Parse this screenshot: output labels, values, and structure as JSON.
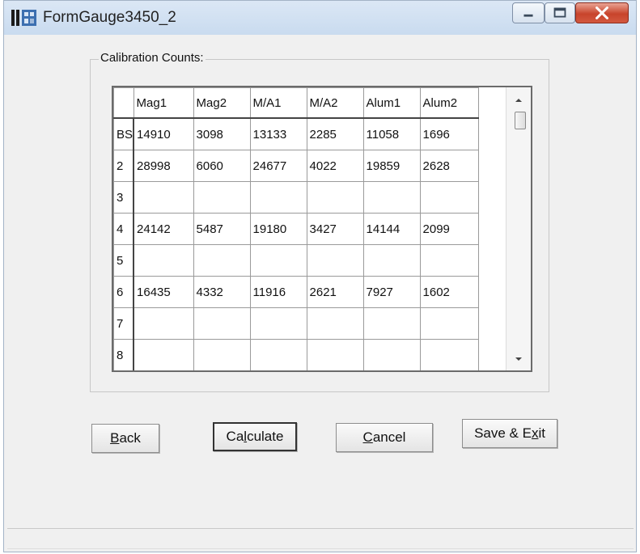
{
  "window": {
    "title": "FormGauge3450_2",
    "icon": "app-grid-icon",
    "controls": [
      "minimize-icon",
      "maximize-icon",
      "close-icon"
    ]
  },
  "calibration": {
    "group_label": "Calibration Counts:",
    "columns": [
      "Mag1",
      "Mag2",
      "M/A1",
      "M/A2",
      "Alum1",
      "Alum2"
    ],
    "rows": [
      {
        "label": "BS",
        "cells": [
          "14910",
          "3098",
          "13133",
          "2285",
          "11058",
          "1696"
        ]
      },
      {
        "label": "2",
        "cells": [
          "28998",
          "6060",
          "24677",
          "4022",
          "19859",
          "2628"
        ]
      },
      {
        "label": "3",
        "cells": [
          "",
          "",
          "",
          "",
          "",
          ""
        ]
      },
      {
        "label": "4",
        "cells": [
          "24142",
          "5487",
          "19180",
          "3427",
          "14144",
          "2099"
        ]
      },
      {
        "label": "5",
        "cells": [
          "",
          "",
          "",
          "",
          "",
          ""
        ]
      },
      {
        "label": "6",
        "cells": [
          "16435",
          "4332",
          "11916",
          "2621",
          "7927",
          "1602"
        ]
      },
      {
        "label": "7",
        "cells": [
          "",
          "",
          "",
          "",
          "",
          ""
        ]
      },
      {
        "label": "8",
        "cells": [
          "",
          "",
          "",
          "",
          "",
          ""
        ]
      }
    ]
  },
  "buttons": {
    "back": {
      "mnemonic": "B",
      "rest": "ack"
    },
    "calculate": {
      "before": "Ca",
      "mnemonic": "l",
      "after": "culate"
    },
    "cancel": {
      "mnemonic": "C",
      "rest": "ancel"
    },
    "save_exit": {
      "before": "Save & E",
      "mnemonic": "x",
      "after": "it"
    }
  },
  "colors": {
    "titlebar": "#c9dbef",
    "close_button": "#c8442c",
    "window_face": "#f0f0f0"
  }
}
